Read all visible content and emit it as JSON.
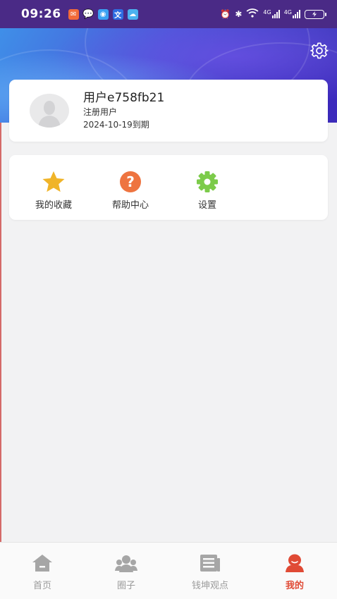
{
  "status_bar": {
    "time": "09:26",
    "network_1": "4G",
    "network_2": "4G"
  },
  "profile": {
    "username": "用户e758fb21",
    "role": "注册用户",
    "expiry": "2024-10-19到期"
  },
  "functions": [
    {
      "label": "我的收藏",
      "icon": "star-icon",
      "color": "#f0b429"
    },
    {
      "label": "帮助中心",
      "icon": "question-icon",
      "color": "#ee7440"
    },
    {
      "label": "设置",
      "icon": "gear-icon",
      "color": "#7ccb4a"
    }
  ],
  "bottom_nav": [
    {
      "label": "首页",
      "icon": "home-icon",
      "active": false
    },
    {
      "label": "圈子",
      "icon": "community-icon",
      "active": false
    },
    {
      "label": "钱坤观点",
      "icon": "news-icon",
      "active": false
    },
    {
      "label": "我的",
      "icon": "user-icon",
      "active": true
    }
  ],
  "colors": {
    "accent": "#e04a35",
    "inactive": "#9b9b9b",
    "status_bar": "#4a2a86"
  }
}
